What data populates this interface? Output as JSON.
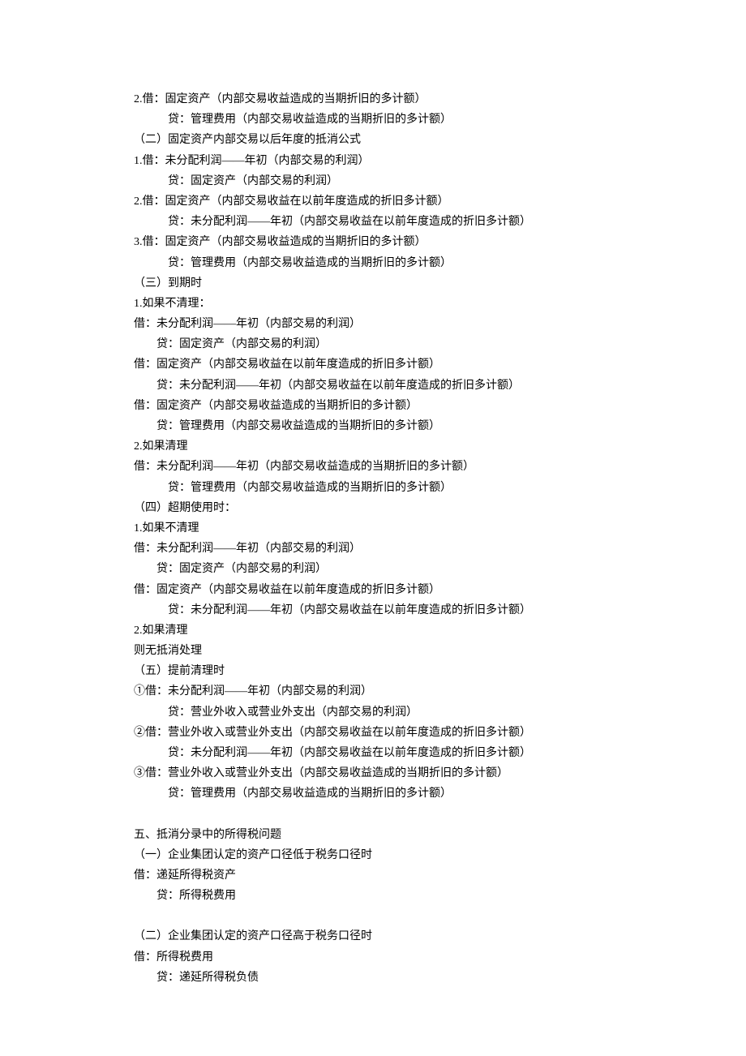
{
  "lines": [
    {
      "cls": "indent1",
      "text": "2.借：固定资产（内部交易收益造成的当期折旧的多计额）"
    },
    {
      "cls": "indent2",
      "text": "贷：管理费用（内部交易收益造成的当期折旧的多计额）"
    },
    {
      "cls": "indent1",
      "text": "（二）固定资产内部交易以后年度的抵消公式"
    },
    {
      "cls": "indent1",
      "text": "1.借：未分配利润——年初（内部交易的利润）"
    },
    {
      "cls": "indent2",
      "text": "贷：固定资产（内部交易的利润）"
    },
    {
      "cls": "indent1",
      "text": "2.借：固定资产（内部交易收益在以前年度造成的折旧多计额）"
    },
    {
      "cls": "indent2",
      "text": "贷：未分配利润——年初（内部交易收益在以前年度造成的折旧多计额）"
    },
    {
      "cls": "indent1",
      "text": "3.借：固定资产（内部交易收益造成的当期折旧的多计额）"
    },
    {
      "cls": "indent2",
      "text": "贷：管理费用（内部交易收益造成的当期折旧的多计额）"
    },
    {
      "cls": "indent1",
      "text": "（三）到期时"
    },
    {
      "cls": "indent1",
      "text": "1.如果不清理："
    },
    {
      "cls": "indent1",
      "text": "借：未分配利润——年初（内部交易的利润）"
    },
    {
      "cls": "indent3",
      "text": "贷：固定资产（内部交易的利润）"
    },
    {
      "cls": "indent1",
      "text": "借：固定资产（内部交易收益在以前年度造成的折旧多计额）"
    },
    {
      "cls": "indent3",
      "text": "贷：未分配利润——年初（内部交易收益在以前年度造成的折旧多计额）"
    },
    {
      "cls": "indent1",
      "text": "借：固定资产（内部交易收益造成的当期折旧的多计额）"
    },
    {
      "cls": "indent3",
      "text": "贷：管理费用（内部交易收益造成的当期折旧的多计额）"
    },
    {
      "cls": "indent1",
      "text": "2.如果清理"
    },
    {
      "cls": "indent1",
      "text": "借：未分配利润——年初（内部交易收益造成的当期折旧的多计额）"
    },
    {
      "cls": "indent2",
      "text": "贷：管理费用（内部交易收益造成的当期折旧的多计额）"
    },
    {
      "cls": "indent1",
      "text": "（四）超期使用时："
    },
    {
      "cls": "indent1",
      "text": "1.如果不清理"
    },
    {
      "cls": "indent1",
      "text": "借：未分配利润——年初（内部交易的利润）"
    },
    {
      "cls": "indent3",
      "text": "贷：固定资产（内部交易的利润）"
    },
    {
      "cls": "indent1",
      "text": "借：固定资产（内部交易收益在以前年度造成的折旧多计额）"
    },
    {
      "cls": "indent2",
      "text": "贷：未分配利润——年初（内部交易收益在以前年度造成的折旧多计额）"
    },
    {
      "cls": "indent1",
      "text": "2.如果清理"
    },
    {
      "cls": "indent1",
      "text": "则无抵消处理"
    },
    {
      "cls": "indent1",
      "text": "（五）提前清理时"
    },
    {
      "cls": "indent1",
      "text": "①借：未分配利润——年初（内部交易的利润）"
    },
    {
      "cls": "indent2",
      "text": "贷：营业外收入或营业外支出（内部交易的利润）"
    },
    {
      "cls": "indent1",
      "text": "②借：营业外收入或营业外支出（内部交易收益在以前年度造成的折旧多计额）"
    },
    {
      "cls": "indent2",
      "text": "贷：未分配利润——年初（内部交易收益在以前年度造成的折旧多计额）"
    },
    {
      "cls": "indent1",
      "text": "③借：营业外收入或营业外支出（内部交易收益造成的当期折旧的多计额）"
    },
    {
      "cls": "indent2",
      "text": "贷：管理费用（内部交易收益造成的当期折旧的多计额）"
    },
    {
      "cls": "blank",
      "text": ""
    },
    {
      "cls": "indent1",
      "text": "五、抵消分录中的所得税问题"
    },
    {
      "cls": "indent1",
      "text": "（一）企业集团认定的资产口径低于税务口径时"
    },
    {
      "cls": "indent1",
      "text": "借：递延所得税资产"
    },
    {
      "cls": "indent3",
      "text": "贷：所得税费用"
    },
    {
      "cls": "blank",
      "text": ""
    },
    {
      "cls": "indent1",
      "text": "（二）企业集团认定的资产口径高于税务口径时"
    },
    {
      "cls": "indent1",
      "text": "借：所得税费用"
    },
    {
      "cls": "indent3",
      "text": "贷：递延所得税负债"
    }
  ]
}
